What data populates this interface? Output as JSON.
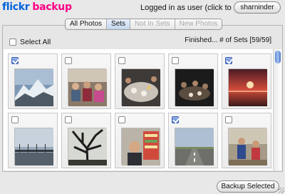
{
  "app": {
    "logo_part1": "flickr",
    "logo_part2": "backup"
  },
  "header": {
    "login_text": "Logged in as user (click to change)",
    "username": "sharninder"
  },
  "tabs": [
    {
      "label": "All Photos",
      "state": "normal"
    },
    {
      "label": "Sets",
      "state": "active"
    },
    {
      "label": "Not In Sets",
      "state": "disabled"
    },
    {
      "label": "New Photos",
      "state": "disabled"
    }
  ],
  "toolbar": {
    "select_all_label": "Select All",
    "status": "Finished... # of Sets [59/59]"
  },
  "photos": [
    {
      "checked": true,
      "scene": "mountain"
    },
    {
      "checked": false,
      "scene": "group"
    },
    {
      "checked": false,
      "scene": "dinner"
    },
    {
      "checked": false,
      "scene": "night"
    },
    {
      "checked": true,
      "scene": "sunset"
    },
    {
      "checked": false,
      "scene": "bridge"
    },
    {
      "checked": false,
      "scene": "tree"
    },
    {
      "checked": false,
      "scene": "shop"
    },
    {
      "checked": true,
      "scene": "road"
    },
    {
      "checked": false,
      "scene": "beach"
    }
  ],
  "footer": {
    "backup_label": "Backup Selected"
  },
  "colors": {
    "brand_blue": "#0063dc",
    "brand_pink": "#ff0084",
    "check_blue": "#4f78d0"
  }
}
